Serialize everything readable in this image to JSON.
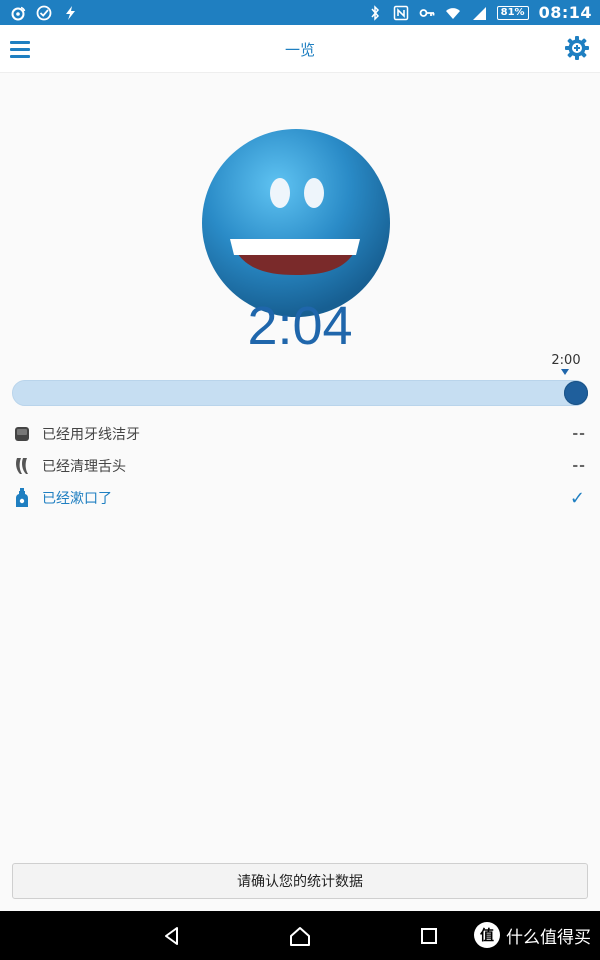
{
  "status_bar": {
    "battery_percent": "81%",
    "time": "08:14",
    "left_icons": [
      "weibo-icon",
      "check-circle-icon",
      "bolt-icon"
    ],
    "right_icons": [
      "bluetooth-icon",
      "nfc-icon",
      "key-icon",
      "wifi-icon",
      "signal-icon",
      "battery-icon"
    ]
  },
  "app_bar": {
    "title": "一览",
    "menu_icon": "menu-icon",
    "settings_icon": "settings-gear-icon"
  },
  "main": {
    "smiley_icon": "smiley-face-icon",
    "timer": "2:04",
    "target_time_label": "2:00",
    "progress_value": 1.0,
    "checklist": [
      {
        "label": "已经用牙线洁牙",
        "status": "--",
        "icon": "floss-icon",
        "active": false
      },
      {
        "label": "已经清理舌头",
        "status": "--",
        "icon": "tongue-cleaner-icon",
        "active": false
      },
      {
        "label": "已经漱口了",
        "status": "✓",
        "icon": "mouthwash-bottle-icon",
        "active": true
      }
    ],
    "confirm_button_label": "请确认您的统计数据"
  },
  "nav_bar": {
    "back_icon": "back-icon",
    "home_icon": "home-icon",
    "recent_icon": "recent-apps-icon"
  },
  "watermark": {
    "text": "什么值得买",
    "badge_char": "值"
  },
  "colors": {
    "accent": "#1f7fc1",
    "timer_blue": "#1f66ab",
    "progress_track": "#c6def2",
    "knob": "#1f5f9c"
  }
}
